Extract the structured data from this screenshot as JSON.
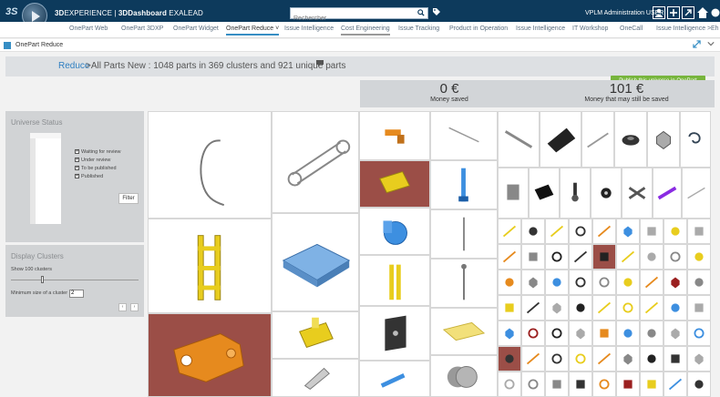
{
  "header": {
    "brand_3ds": "3S",
    "app_prefix": "3D",
    "app_experience": "EXPERIENCE",
    "app_separator": " | ",
    "app_dashboard": "3DDashboard",
    "app_suffix": " EXALEAD",
    "search_placeholder": "Rechercher",
    "user_name": "VPLM Administration USER"
  },
  "tabs": [
    {
      "label": "OnePart Web"
    },
    {
      "label": "OnePart 3DXP"
    },
    {
      "label": "OnePart Widget"
    },
    {
      "label": "OnePart Reduce ˅"
    },
    {
      "label": "Issue Intelligence"
    },
    {
      "label": "Cost Engineering"
    },
    {
      "label": "Issue Tracking"
    },
    {
      "label": "Product in Operation"
    },
    {
      "label": "Issue Intelligence"
    },
    {
      "label": "IT Workshop"
    },
    {
      "label": "OneCall"
    },
    {
      "label": "Issue Intelligence ˃"
    },
    {
      "label": "Eh"
    }
  ],
  "widget": {
    "title": "OnePart Reduce"
  },
  "breadcrumb": {
    "link": "Reduce",
    "text": ">All Parts New : 1048 parts in 369 clusters and 921 unique parts"
  },
  "actions": {
    "publish_label": "Publish this universe in OnePart"
  },
  "stats": [
    {
      "amount": "0 €",
      "label": "Money saved"
    },
    {
      "amount": "101 €",
      "label": "Money that may still be saved"
    }
  ],
  "universe_status": {
    "title": "Universe Status",
    "items": [
      {
        "label": "Waiting for review",
        "checked": true
      },
      {
        "label": "Under review",
        "checked": true
      },
      {
        "label": "To be published",
        "checked": true
      },
      {
        "label": "Published",
        "checked": true
      }
    ],
    "filter_label": "Filter"
  },
  "display_clusters": {
    "title": "Display Clusters",
    "show_label": "Show 100 clusters",
    "min_size_label": "Minimum size of a cluster",
    "min_size_value": "2",
    "prev_label": "‹",
    "next_label": "›"
  },
  "icons": {
    "search": "search-icon",
    "tag": "tag-icon",
    "user": "user-icon",
    "add": "plus-icon",
    "share": "share-icon",
    "home": "home-icon",
    "help": "help-icon"
  },
  "colors": {
    "topbar": "#0d3a5c",
    "accent": "#368ec4",
    "publish": "#77b53d",
    "tile_red": "#9b4e47",
    "part_yellow": "#e8cd1e",
    "part_orange": "#e68a1e",
    "part_blue": "#3d8fe0"
  }
}
